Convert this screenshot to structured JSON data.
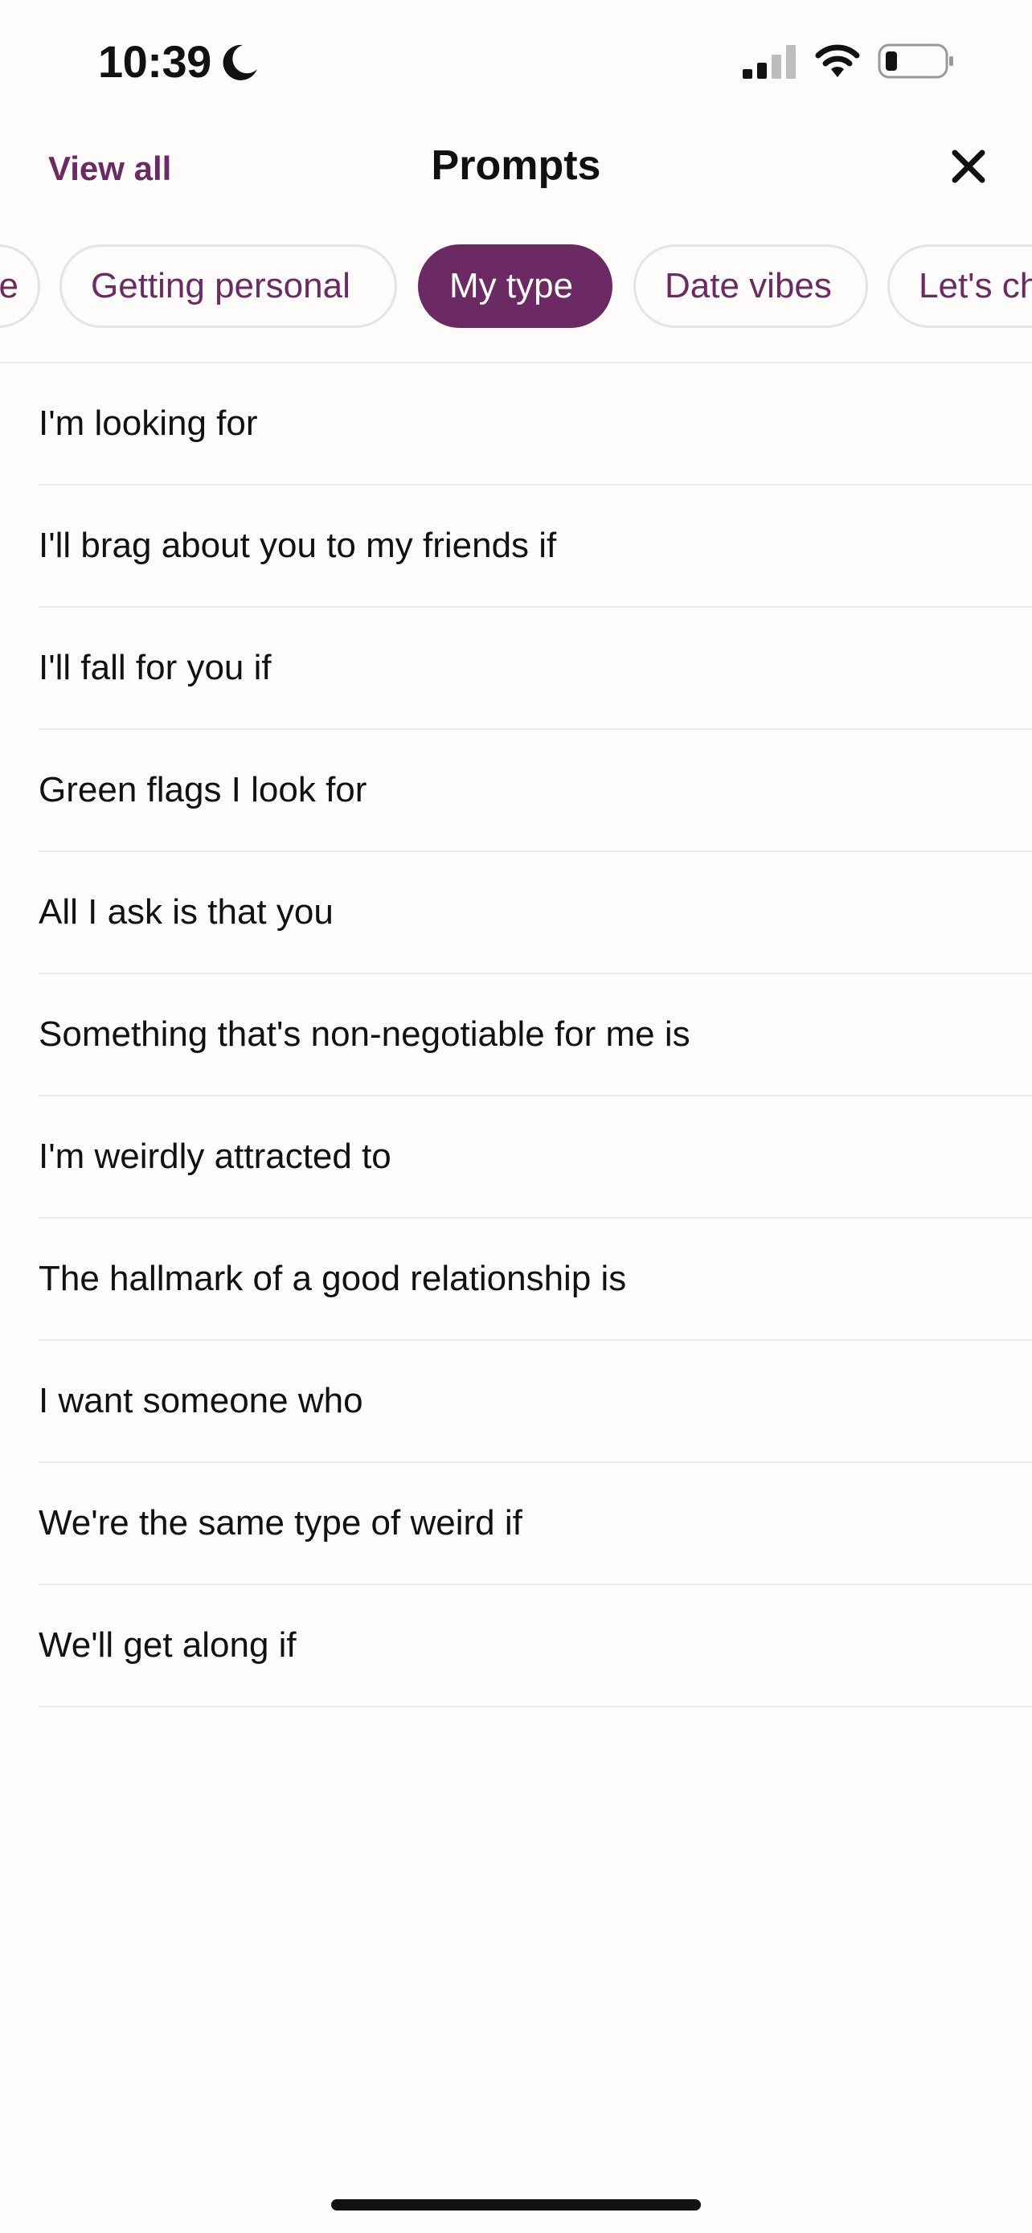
{
  "status_bar": {
    "time": "10:39",
    "icons": [
      "moon-icon",
      "signal-icon",
      "wifi-icon",
      "battery-icon"
    ]
  },
  "header": {
    "view_all_label": "View all",
    "title": "Prompts",
    "close_icon": "close-icon"
  },
  "tabs": [
    {
      "label": "e",
      "active": false
    },
    {
      "label": "Getting personal",
      "active": false
    },
    {
      "label": "My type",
      "active": true
    },
    {
      "label": "Date vibes",
      "active": false
    },
    {
      "label": "Let's ch",
      "active": false
    }
  ],
  "prompts": [
    "I'm looking for",
    "I'll brag about you to my friends if",
    "I'll fall for you if",
    "Green flags I look for",
    "All I ask is that you",
    "Something that's non-negotiable for me is",
    "I'm weirdly attracted to",
    "The hallmark of a good relationship is",
    "I want someone who",
    "We're the same type of weird if",
    "We'll get along if"
  ],
  "colors": {
    "accent": "#6B2A63",
    "background": "#FDFCFB",
    "divider": "#ECEAEA"
  }
}
